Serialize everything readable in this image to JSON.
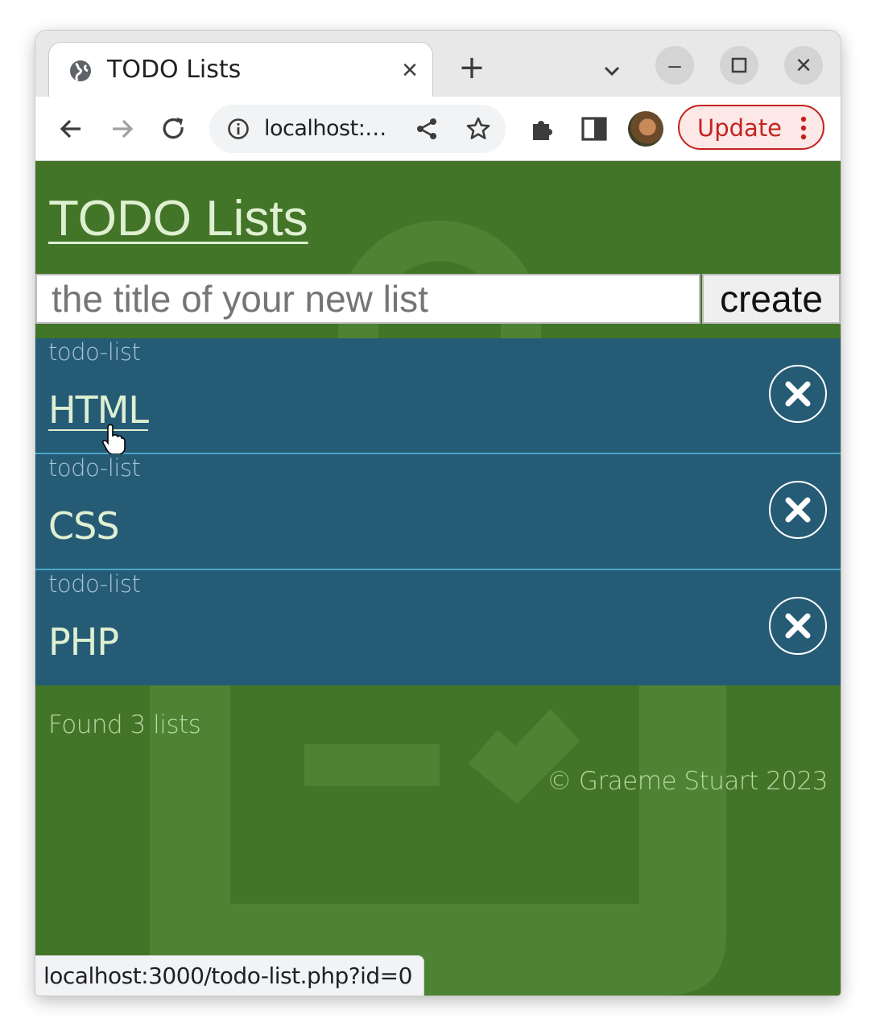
{
  "browser": {
    "tab_title": "TODO Lists",
    "tab_close": "×",
    "new_tab": "+",
    "omnibox_url": "localhost:…",
    "update_label": "Update",
    "window_minimize": "–",
    "window_close": "×"
  },
  "page": {
    "title": "TODO Lists",
    "new_list_placeholder": "the title of your new list",
    "create_label": "create",
    "lists": [
      {
        "kind": "todo-list",
        "name": "HTML"
      },
      {
        "kind": "todo-list",
        "name": "CSS"
      },
      {
        "kind": "todo-list",
        "name": "PHP"
      }
    ],
    "found_text": "Found 3 lists",
    "copyright": "© Graeme Stuart 2023"
  },
  "status_bar": {
    "url": "localhost:3000/todo-list.php?id=0"
  },
  "colors": {
    "page_bg": "#437528",
    "list_bg": "#265b76",
    "list_divider": "#4aa6c9",
    "update_accent": "#c5221f"
  }
}
